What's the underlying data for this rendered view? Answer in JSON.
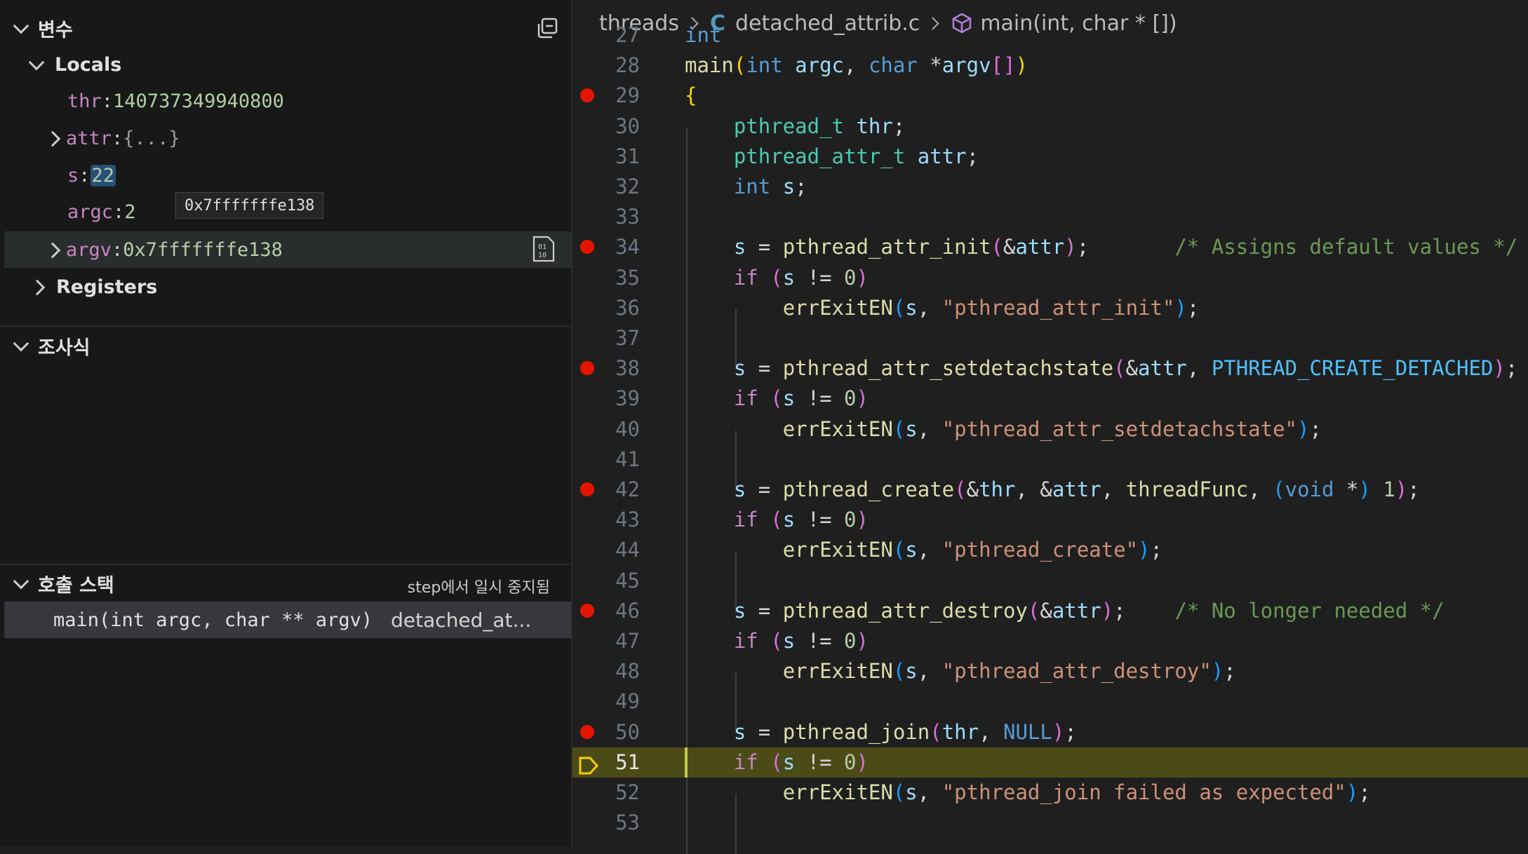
{
  "sidebar": {
    "variables": {
      "title": "변수",
      "locals": {
        "title": "Locals",
        "items": [
          {
            "name": "thr",
            "value": "140737349940800"
          },
          {
            "name": "attr",
            "value": "{...}"
          },
          {
            "name": "s",
            "value": "22"
          },
          {
            "name": "argc",
            "value": "2"
          },
          {
            "name": "argv",
            "value": "0x7fffffffe138"
          }
        ]
      },
      "registers": {
        "title": "Registers"
      },
      "tooltip": "0x7fffffffe138"
    },
    "watch": {
      "title": "조사식"
    },
    "callstack": {
      "title": "호출 스택",
      "status": "step에서 일시 중지됨",
      "frame": {
        "func": "main(int argc, char ** argv)",
        "file": "detached_at..."
      }
    }
  },
  "editor": {
    "breadcrumb": {
      "folder": "threads",
      "file": "detached_attrib.c",
      "file_icon": "C",
      "symbol": "main(int, char * [])"
    },
    "current_line": 51,
    "breakpoints": [
      29,
      34,
      38,
      42,
      46,
      50
    ],
    "lines": [
      {
        "n": "27",
        "tokens": [
          {
            "t": "int",
            "c": "k"
          }
        ]
      },
      {
        "n": "28",
        "tokens": [
          {
            "t": "main",
            "c": "f"
          },
          {
            "t": "(",
            "c": "b1"
          },
          {
            "t": "int",
            "c": "k"
          },
          {
            "t": " ",
            "c": "p"
          },
          {
            "t": "argc",
            "c": "v"
          },
          {
            "t": ", ",
            "c": "p"
          },
          {
            "t": "char",
            "c": "k"
          },
          {
            "t": " *",
            "c": "p"
          },
          {
            "t": "argv",
            "c": "v"
          },
          {
            "t": "[]",
            "c": "b2"
          },
          {
            "t": ")",
            "c": "b1"
          }
        ]
      },
      {
        "n": "29",
        "tokens": [
          {
            "t": "{",
            "c": "b1"
          }
        ]
      },
      {
        "n": "30",
        "tokens": [
          {
            "t": "    ",
            "c": "p"
          },
          {
            "t": "pthread_t",
            "c": "t"
          },
          {
            "t": " ",
            "c": "p"
          },
          {
            "t": "thr",
            "c": "v"
          },
          {
            "t": ";",
            "c": "p"
          }
        ]
      },
      {
        "n": "31",
        "tokens": [
          {
            "t": "    ",
            "c": "p"
          },
          {
            "t": "pthread_attr_t",
            "c": "t"
          },
          {
            "t": " ",
            "c": "p"
          },
          {
            "t": "attr",
            "c": "v"
          },
          {
            "t": ";",
            "c": "p"
          }
        ]
      },
      {
        "n": "32",
        "tokens": [
          {
            "t": "    ",
            "c": "p"
          },
          {
            "t": "int",
            "c": "k"
          },
          {
            "t": " ",
            "c": "p"
          },
          {
            "t": "s",
            "c": "v"
          },
          {
            "t": ";",
            "c": "p"
          }
        ]
      },
      {
        "n": "33",
        "tokens": []
      },
      {
        "n": "34",
        "tokens": [
          {
            "t": "    ",
            "c": "p"
          },
          {
            "t": "s",
            "c": "v"
          },
          {
            "t": " = ",
            "c": "p"
          },
          {
            "t": "pthread_attr_init",
            "c": "f"
          },
          {
            "t": "(",
            "c": "b2"
          },
          {
            "t": "&",
            "c": "p"
          },
          {
            "t": "attr",
            "c": "v"
          },
          {
            "t": ")",
            "c": "b2"
          },
          {
            "t": ";       ",
            "c": "p"
          },
          {
            "t": "/* Assigns default values */",
            "c": "cm"
          }
        ]
      },
      {
        "n": "35",
        "tokens": [
          {
            "t": "    ",
            "c": "p"
          },
          {
            "t": "if",
            "c": "ctl"
          },
          {
            "t": " ",
            "c": "p"
          },
          {
            "t": "(",
            "c": "b2"
          },
          {
            "t": "s",
            "c": "v"
          },
          {
            "t": " != ",
            "c": "p"
          },
          {
            "t": "0",
            "c": "n"
          },
          {
            "t": ")",
            "c": "b2"
          }
        ]
      },
      {
        "n": "36",
        "tokens": [
          {
            "t": "        ",
            "c": "p"
          },
          {
            "t": "errExitEN",
            "c": "f"
          },
          {
            "t": "(",
            "c": "b3"
          },
          {
            "t": "s",
            "c": "v"
          },
          {
            "t": ", ",
            "c": "p"
          },
          {
            "t": "\"pthread_attr_init\"",
            "c": "s"
          },
          {
            "t": ")",
            "c": "b3"
          },
          {
            "t": ";",
            "c": "p"
          }
        ]
      },
      {
        "n": "37",
        "tokens": []
      },
      {
        "n": "38",
        "tokens": [
          {
            "t": "    ",
            "c": "p"
          },
          {
            "t": "s",
            "c": "v"
          },
          {
            "t": " = ",
            "c": "p"
          },
          {
            "t": "pthread_attr_setdetachstate",
            "c": "f"
          },
          {
            "t": "(",
            "c": "b2"
          },
          {
            "t": "&",
            "c": "p"
          },
          {
            "t": "attr",
            "c": "v"
          },
          {
            "t": ", ",
            "c": "p"
          },
          {
            "t": "PTHREAD_CREATE_DETACHED",
            "c": "cn"
          },
          {
            "t": ")",
            "c": "b2"
          },
          {
            "t": ";",
            "c": "p"
          }
        ]
      },
      {
        "n": "39",
        "tokens": [
          {
            "t": "    ",
            "c": "p"
          },
          {
            "t": "if",
            "c": "ctl"
          },
          {
            "t": " ",
            "c": "p"
          },
          {
            "t": "(",
            "c": "b2"
          },
          {
            "t": "s",
            "c": "v"
          },
          {
            "t": " != ",
            "c": "p"
          },
          {
            "t": "0",
            "c": "n"
          },
          {
            "t": ")",
            "c": "b2"
          }
        ]
      },
      {
        "n": "40",
        "tokens": [
          {
            "t": "        ",
            "c": "p"
          },
          {
            "t": "errExitEN",
            "c": "f"
          },
          {
            "t": "(",
            "c": "b3"
          },
          {
            "t": "s",
            "c": "v"
          },
          {
            "t": ", ",
            "c": "p"
          },
          {
            "t": "\"pthread_attr_setdetachstate\"",
            "c": "s"
          },
          {
            "t": ")",
            "c": "b3"
          },
          {
            "t": ";",
            "c": "p"
          }
        ]
      },
      {
        "n": "41",
        "tokens": []
      },
      {
        "n": "42",
        "tokens": [
          {
            "t": "    ",
            "c": "p"
          },
          {
            "t": "s",
            "c": "v"
          },
          {
            "t": " = ",
            "c": "p"
          },
          {
            "t": "pthread_create",
            "c": "f"
          },
          {
            "t": "(",
            "c": "b2"
          },
          {
            "t": "&",
            "c": "p"
          },
          {
            "t": "thr",
            "c": "v"
          },
          {
            "t": ", &",
            "c": "p"
          },
          {
            "t": "attr",
            "c": "v"
          },
          {
            "t": ", ",
            "c": "p"
          },
          {
            "t": "threadFunc",
            "c": "f"
          },
          {
            "t": ", ",
            "c": "p"
          },
          {
            "t": "(",
            "c": "b3"
          },
          {
            "t": "void",
            "c": "k"
          },
          {
            "t": " *",
            "c": "p"
          },
          {
            "t": ")",
            "c": "b3"
          },
          {
            "t": " ",
            "c": "p"
          },
          {
            "t": "1",
            "c": "n"
          },
          {
            "t": ")",
            "c": "b2"
          },
          {
            "t": ";",
            "c": "p"
          }
        ]
      },
      {
        "n": "43",
        "tokens": [
          {
            "t": "    ",
            "c": "p"
          },
          {
            "t": "if",
            "c": "ctl"
          },
          {
            "t": " ",
            "c": "p"
          },
          {
            "t": "(",
            "c": "b2"
          },
          {
            "t": "s",
            "c": "v"
          },
          {
            "t": " != ",
            "c": "p"
          },
          {
            "t": "0",
            "c": "n"
          },
          {
            "t": ")",
            "c": "b2"
          }
        ]
      },
      {
        "n": "44",
        "tokens": [
          {
            "t": "        ",
            "c": "p"
          },
          {
            "t": "errExitEN",
            "c": "f"
          },
          {
            "t": "(",
            "c": "b3"
          },
          {
            "t": "s",
            "c": "v"
          },
          {
            "t": ", ",
            "c": "p"
          },
          {
            "t": "\"pthread_create\"",
            "c": "s"
          },
          {
            "t": ")",
            "c": "b3"
          },
          {
            "t": ";",
            "c": "p"
          }
        ]
      },
      {
        "n": "45",
        "tokens": []
      },
      {
        "n": "46",
        "tokens": [
          {
            "t": "    ",
            "c": "p"
          },
          {
            "t": "s",
            "c": "v"
          },
          {
            "t": " = ",
            "c": "p"
          },
          {
            "t": "pthread_attr_destroy",
            "c": "f"
          },
          {
            "t": "(",
            "c": "b2"
          },
          {
            "t": "&",
            "c": "p"
          },
          {
            "t": "attr",
            "c": "v"
          },
          {
            "t": ")",
            "c": "b2"
          },
          {
            "t": ";    ",
            "c": "p"
          },
          {
            "t": "/* No longer needed */",
            "c": "cm"
          }
        ]
      },
      {
        "n": "47",
        "tokens": [
          {
            "t": "    ",
            "c": "p"
          },
          {
            "t": "if",
            "c": "ctl"
          },
          {
            "t": " ",
            "c": "p"
          },
          {
            "t": "(",
            "c": "b2"
          },
          {
            "t": "s",
            "c": "v"
          },
          {
            "t": " != ",
            "c": "p"
          },
          {
            "t": "0",
            "c": "n"
          },
          {
            "t": ")",
            "c": "b2"
          }
        ]
      },
      {
        "n": "48",
        "tokens": [
          {
            "t": "        ",
            "c": "p"
          },
          {
            "t": "errExitEN",
            "c": "f"
          },
          {
            "t": "(",
            "c": "b3"
          },
          {
            "t": "s",
            "c": "v"
          },
          {
            "t": ", ",
            "c": "p"
          },
          {
            "t": "\"pthread_attr_destroy\"",
            "c": "s"
          },
          {
            "t": ")",
            "c": "b3"
          },
          {
            "t": ";",
            "c": "p"
          }
        ]
      },
      {
        "n": "49",
        "tokens": []
      },
      {
        "n": "50",
        "tokens": [
          {
            "t": "    ",
            "c": "p"
          },
          {
            "t": "s",
            "c": "v"
          },
          {
            "t": " = ",
            "c": "p"
          },
          {
            "t": "pthread_join",
            "c": "f"
          },
          {
            "t": "(",
            "c": "b2"
          },
          {
            "t": "thr",
            "c": "v"
          },
          {
            "t": ", ",
            "c": "p"
          },
          {
            "t": "NULL",
            "c": "k"
          },
          {
            "t": ")",
            "c": "b2"
          },
          {
            "t": ";",
            "c": "p"
          }
        ]
      },
      {
        "n": "51",
        "tokens": [
          {
            "t": "    ",
            "c": "p"
          },
          {
            "t": "if",
            "c": "ctl"
          },
          {
            "t": " ",
            "c": "p"
          },
          {
            "t": "(",
            "c": "b2"
          },
          {
            "t": "s",
            "c": "v"
          },
          {
            "t": " != ",
            "c": "p"
          },
          {
            "t": "0",
            "c": "n"
          },
          {
            "t": ")",
            "c": "b2"
          }
        ]
      },
      {
        "n": "52",
        "tokens": [
          {
            "t": "        ",
            "c": "p"
          },
          {
            "t": "errExitEN",
            "c": "f"
          },
          {
            "t": "(",
            "c": "b3"
          },
          {
            "t": "s",
            "c": "v"
          },
          {
            "t": ", ",
            "c": "p"
          },
          {
            "t": "\"pthread_join failed as expected\"",
            "c": "s"
          },
          {
            "t": ")",
            "c": "b3"
          },
          {
            "t": ";",
            "c": "p"
          }
        ]
      },
      {
        "n": "53",
        "tokens": []
      }
    ]
  },
  "colors": {
    "breakpoint": "#e51400",
    "current_line_bg": "#4b4b18",
    "current_arrow": "#ffcc00",
    "selection": "#264f78"
  }
}
